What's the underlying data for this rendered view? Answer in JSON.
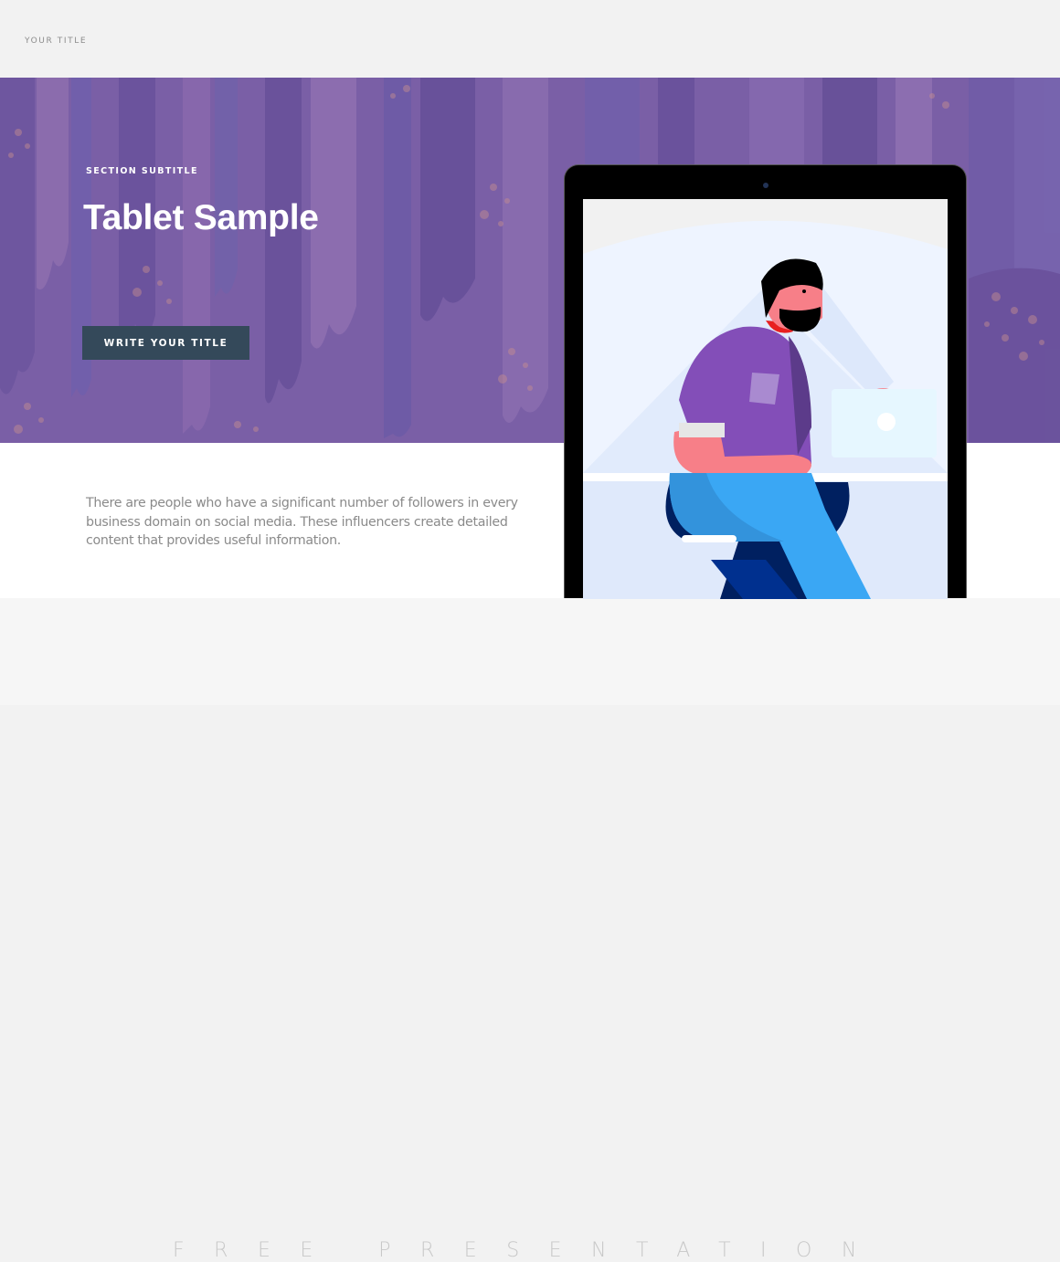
{
  "header": {
    "title": "YOUR TITLE"
  },
  "hero": {
    "subtitle": "SECTION SUBTITLE",
    "title": "Tablet Sample",
    "cta_label": "WRITE YOUR TITLE",
    "background_color": "#7a5fa6",
    "button_color": "#34495a"
  },
  "content": {
    "paragraph": "There are people who have a significant number of followers in every business domain on social media. These influencers create detailed content that provides useful information."
  },
  "footer": {
    "text": "FREE PRESENTATION"
  },
  "tablet": {
    "illustration": "man-sitting-at-laptop"
  }
}
